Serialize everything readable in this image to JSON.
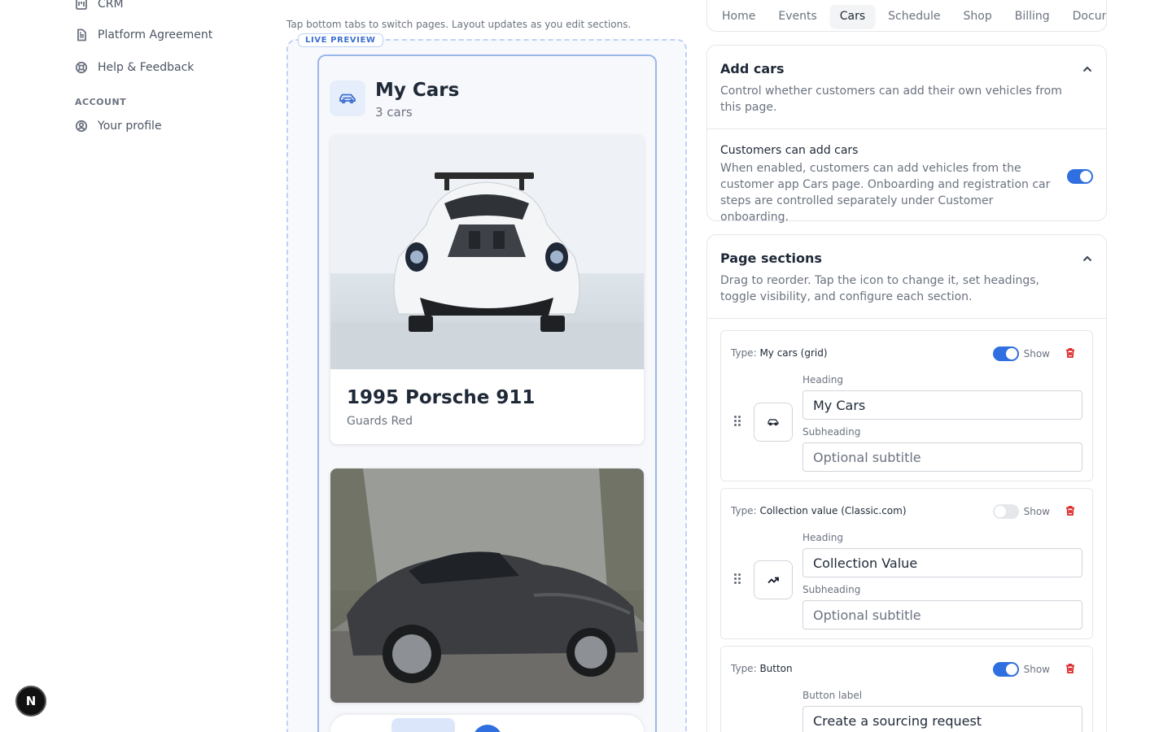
{
  "sidebar": {
    "items": [
      {
        "label": "CRM"
      },
      {
        "label": "Platform Agreement"
      },
      {
        "label": "Help & Feedback"
      }
    ],
    "account_section": "ACCOUNT",
    "account_items": [
      {
        "label": "Your profile"
      }
    ],
    "fab_label": "N"
  },
  "preview": {
    "hint": "Tap bottom tabs to switch pages. Layout updates as you edit sections.",
    "badge": "LIVE PREVIEW",
    "page_title": "My Cars",
    "page_subtitle": "3 cars",
    "cars": [
      {
        "name": "1995 Porsche 911",
        "color": "Guards Red"
      }
    ]
  },
  "tabs": [
    {
      "label": "Home",
      "active": false
    },
    {
      "label": "Events",
      "active": false
    },
    {
      "label": "Cars",
      "active": true
    },
    {
      "label": "Schedule",
      "active": false
    },
    {
      "label": "Shop",
      "active": false
    },
    {
      "label": "Billing",
      "active": false
    },
    {
      "label": "Documents",
      "active": false
    }
  ],
  "add_cars": {
    "title": "Add cars",
    "description": "Control whether customers can add their own vehicles from this page.",
    "setting_title": "Customers can add cars",
    "setting_description": "When enabled, customers can add vehicles from the customer app Cars page. Onboarding and registration car steps are controlled separately under Customer onboarding.",
    "enabled": true
  },
  "page_sections": {
    "title": "Page sections",
    "description": "Drag to reorder. Tap the icon to change it, set headings, toggle visibility, and configure each section.",
    "type_prefix": "Type:",
    "show_label": "Show",
    "sections": [
      {
        "type": "My cars (grid)",
        "shown": true,
        "icon": "car-icon",
        "heading_label": "Heading",
        "heading": "My Cars",
        "subheading_label": "Subheading",
        "subheading_placeholder": "Optional subtitle"
      },
      {
        "type": "Collection value (Classic.com)",
        "shown": false,
        "icon": "trending-up-icon",
        "heading_label": "Heading",
        "heading": "Collection Value",
        "subheading_label": "Subheading",
        "subheading_placeholder": "Optional subtitle"
      },
      {
        "type": "Button",
        "shown": true,
        "button_label_label": "Button label",
        "button_label": "Create a sourcing request"
      }
    ]
  },
  "colors": {
    "accent": "#2f6fdf",
    "danger": "#dc2626",
    "preview_border": "#9ab7ea"
  }
}
